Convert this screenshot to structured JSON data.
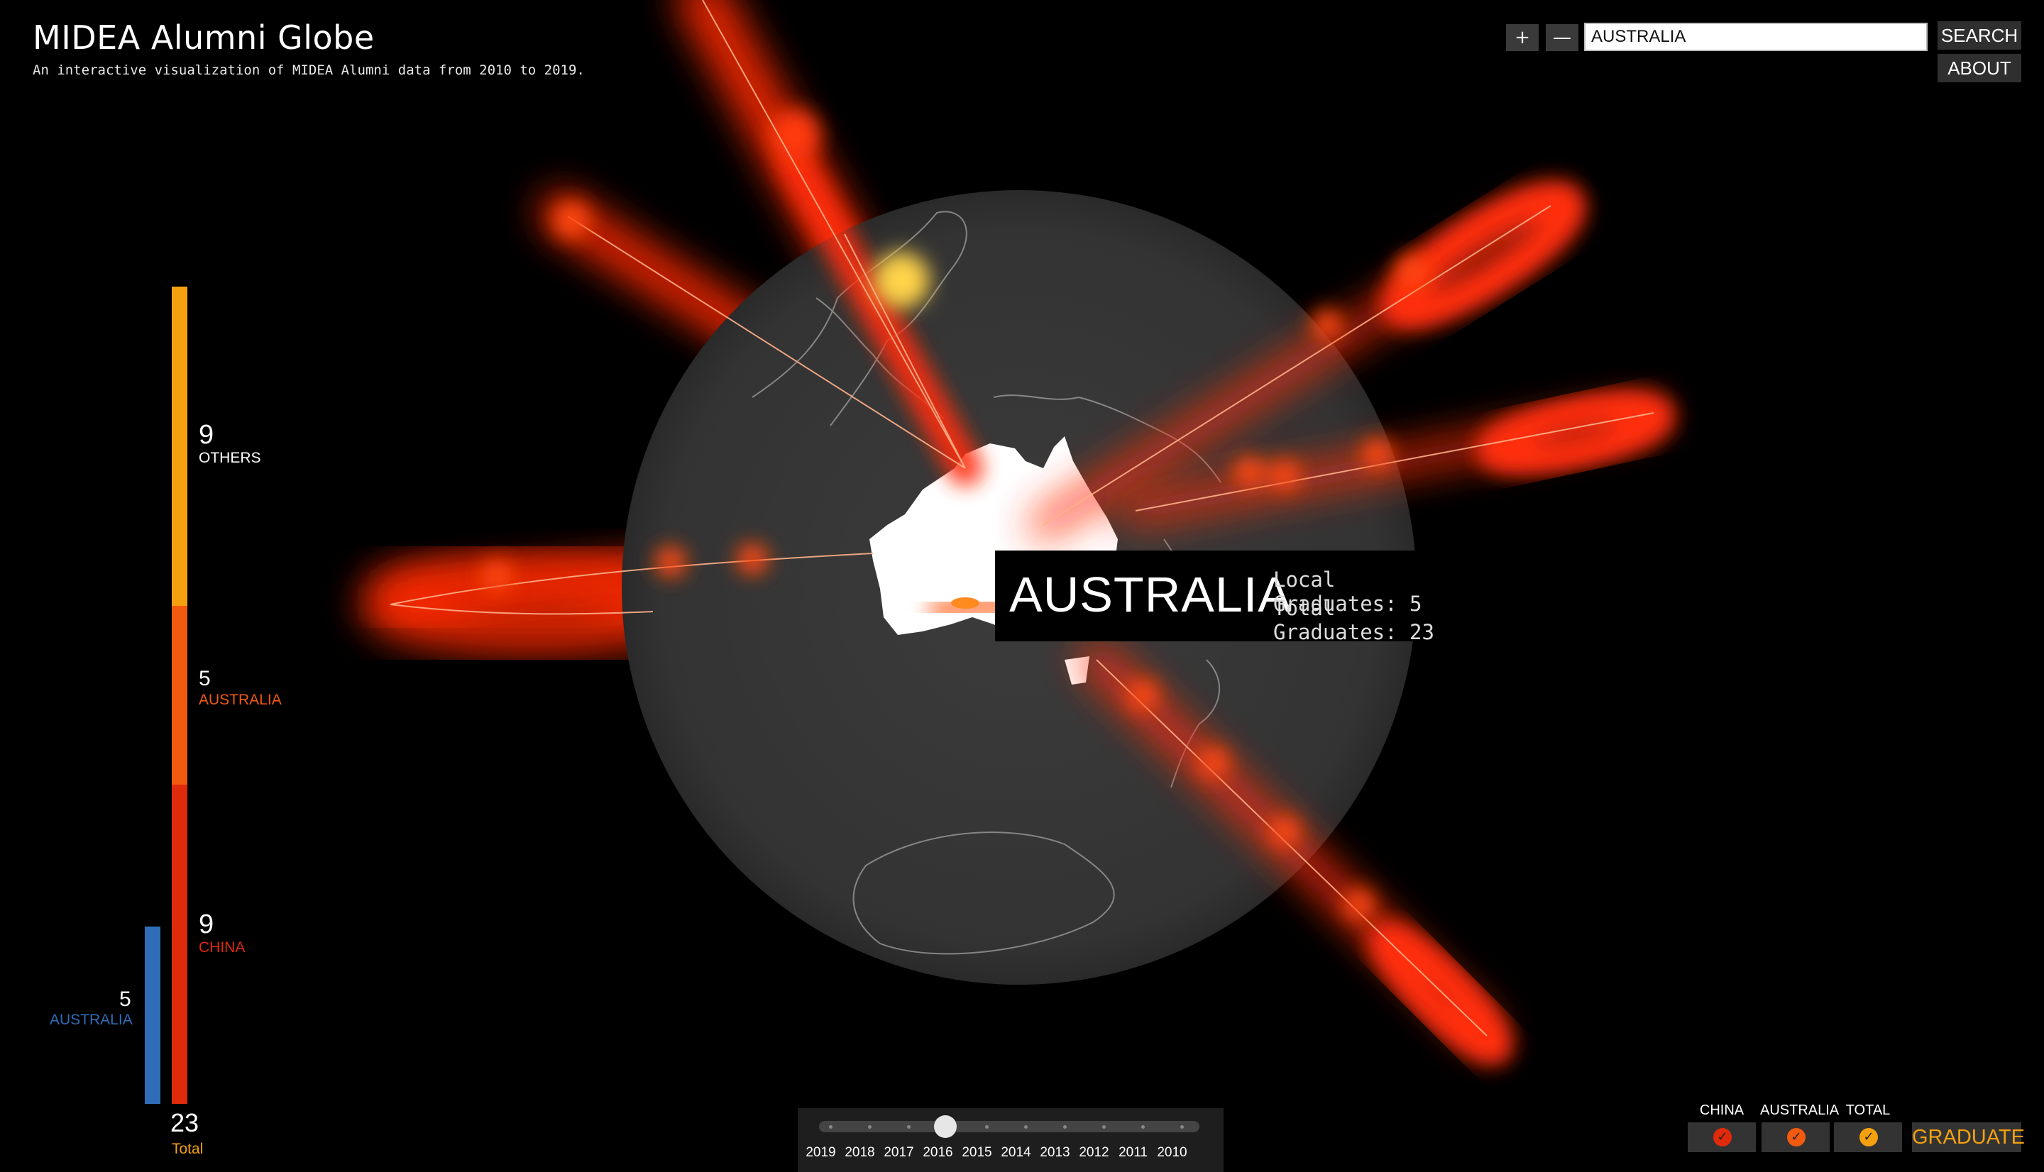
{
  "app": {
    "title": "MIDEA Alumni Globe",
    "subtitle": "An interactive visualization of MIDEA Alumni data from 2010 to 2019."
  },
  "controls": {
    "zoom_in": "+",
    "zoom_out": "—",
    "search_value": "AUSTRALIA",
    "search_label": "SEARCH",
    "about_label": "ABOUT"
  },
  "bar_chart": {
    "segments": [
      {
        "key": "others",
        "value": "9",
        "label": "OTHERS",
        "color": "#f5a10f"
      },
      {
        "key": "australia",
        "value": "5",
        "label": "AUSTRALIA",
        "color": "#f25a0f"
      },
      {
        "key": "china",
        "value": "9",
        "label": "CHINA",
        "color": "#e02a0c"
      }
    ],
    "local": {
      "value": "5",
      "label": "AUSTRALIA",
      "color": "#2f6db8"
    },
    "total": {
      "value": "23",
      "label": "Total",
      "color": "#f5a10f"
    }
  },
  "tooltip": {
    "country": "AUSTRALIA",
    "local_line": "Local Graduates: 5",
    "total_line": "Total Graduates: 23"
  },
  "timeline": {
    "years": [
      "2019",
      "2018",
      "2017",
      "2016",
      "2015",
      "2014",
      "2013",
      "2012",
      "2011",
      "2010"
    ],
    "selected": "2016"
  },
  "filters": {
    "items": [
      {
        "label": "CHINA",
        "color": "#e02a0c",
        "checked": true
      },
      {
        "label": "AUSTRALIA",
        "color": "#f25a0f",
        "checked": true
      },
      {
        "label": "TOTAL",
        "color": "#f5a10f",
        "checked": true
      }
    ],
    "graduate_label": "GRADUATE"
  },
  "colors": {
    "glow": "#ff3a0a",
    "globe": "#3a3a3a",
    "land_highlight": "#ffffff",
    "accent": "#f5a10f"
  }
}
